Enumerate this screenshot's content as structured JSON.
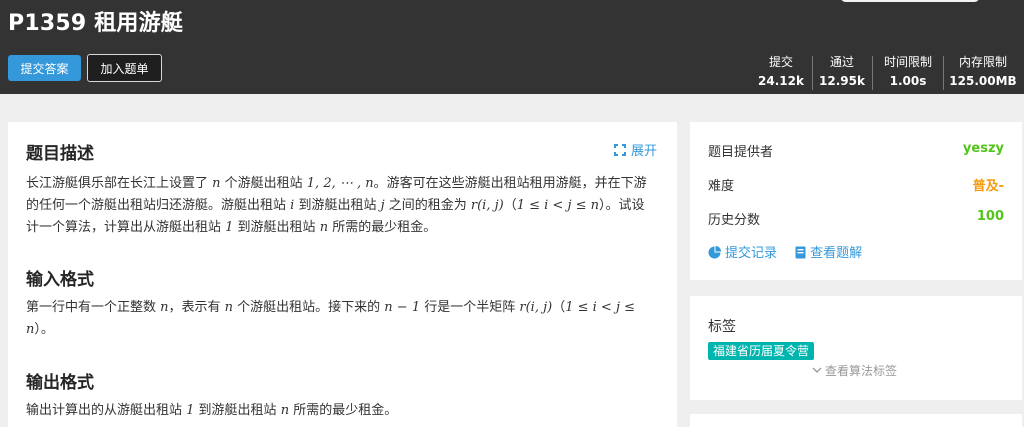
{
  "header": {
    "title": "P1359 租用游艇",
    "submit_label": "提交答案",
    "add_label": "加入题单",
    "stats": [
      {
        "label": "提交",
        "value": "24.12k"
      },
      {
        "label": "通过",
        "value": "12.95k"
      },
      {
        "label": "时间限制",
        "value": "1.00s"
      },
      {
        "label": "内存限制",
        "value": "125.00MB"
      }
    ]
  },
  "problem": {
    "desc_title": "题目描述",
    "expand_label": "展开",
    "desc": {
      "t1": "长江游艇俱乐部在长江上设置了 ",
      "m1": "n",
      "t2": " 个游艇出租站 ",
      "m2": "1, 2, ⋯ , n",
      "t3": "。游客可在这些游艇出租站租用游艇，并在下游的任何一个游艇出租站归还游艇。游艇出租站 ",
      "m3": "i",
      "t4": " 到游艇出租站 ",
      "m4": "j",
      "t5": " 之间的租金为 ",
      "m5": "r(i, j)",
      "t6": "（",
      "m6": "1 ≤ i < j ≤ n",
      "t7": "）。试设计一个算法，计算出从游艇出租站 ",
      "m7": "1",
      "t8": " 到游艇出租站 ",
      "m8": "n",
      "t9": " 所需的最少租金。"
    },
    "input_title": "输入格式",
    "input": {
      "t1": "第一行中有一个正整数 ",
      "m1": "n",
      "t2": "，表示有 ",
      "m2": "n",
      "t3": " 个游艇出租站。接下来的 ",
      "m3": "n − 1",
      "t4": " 行是一个半矩阵 ",
      "m4": "r(i, j)",
      "t5": "（",
      "m5": "1 ≤ i < j ≤ n",
      "t6": "）。"
    },
    "output_title": "输出格式",
    "output": {
      "t1": "输出计算出的从游艇出租站 ",
      "m1": "1",
      "t2": " 到游艇出租站 ",
      "m2": "n",
      "t3": " 所需的最少租金。"
    }
  },
  "side": {
    "provider_label": "题目提供者",
    "provider_value": "yeszy",
    "difficulty_label": "难度",
    "difficulty_value": "普及-",
    "score_label": "历史分数",
    "score_value": "100",
    "records_label": "提交记录",
    "solutions_label": "查看题解",
    "tags_title": "标签",
    "tag": "福建省历届夏令营",
    "view_tags": "查看算法标签"
  },
  "colors": {
    "header_bg": "#333333",
    "accent": "#3498db",
    "provider": "#52c41a",
    "difficulty": "#f39c11",
    "score": "#52c41a",
    "tag": "#00b5ad"
  }
}
